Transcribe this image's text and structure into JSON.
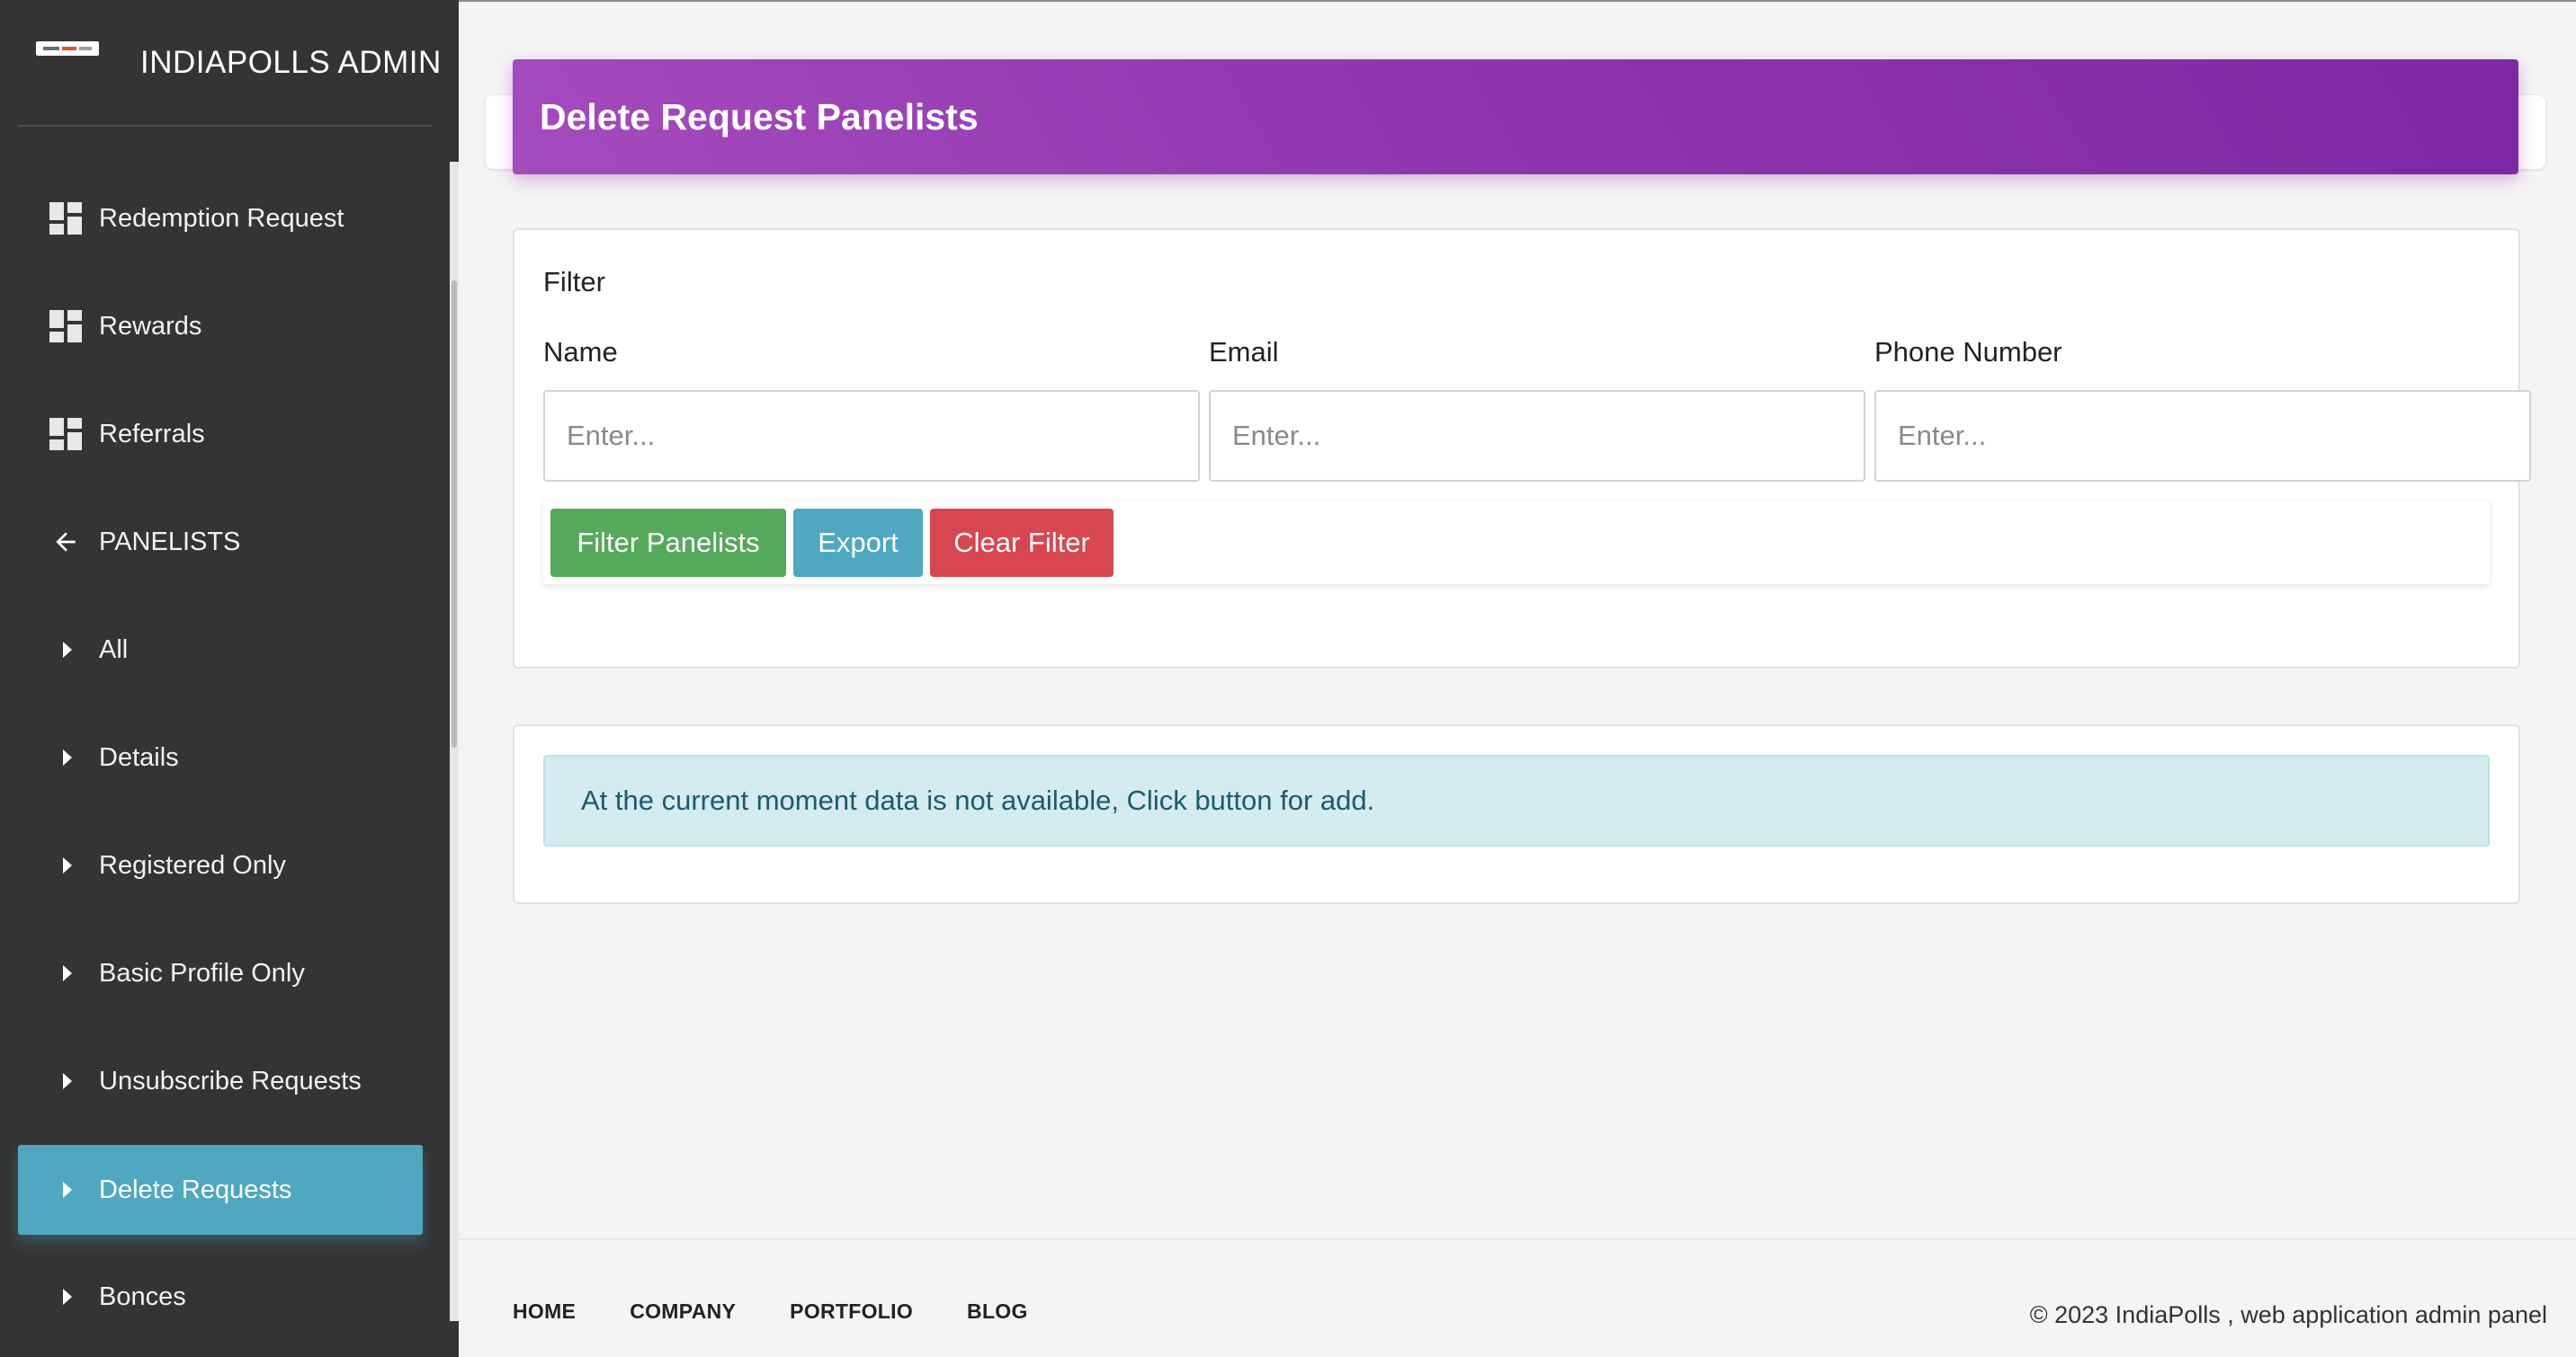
{
  "app": {
    "brand_title": "INDIAPOLLS ADMIN"
  },
  "sidebar": {
    "items": [
      {
        "label": "Redemption Request",
        "icon": "dashboard-icon"
      },
      {
        "label": "Rewards",
        "icon": "dashboard-icon"
      },
      {
        "label": "Referrals",
        "icon": "dashboard-icon"
      },
      {
        "label": "PANELISTS",
        "icon": "arrow-back-icon"
      },
      {
        "label": "All",
        "icon": "caret-right-icon"
      },
      {
        "label": "Details",
        "icon": "caret-right-icon"
      },
      {
        "label": "Registered Only",
        "icon": "caret-right-icon"
      },
      {
        "label": "Basic Profile Only",
        "icon": "caret-right-icon"
      },
      {
        "label": "Unsubscribe Requests",
        "icon": "caret-right-icon"
      },
      {
        "label": "Delete Requests",
        "icon": "caret-right-icon",
        "active": true
      },
      {
        "label": "Bonces",
        "icon": "caret-right-icon"
      }
    ]
  },
  "header": {
    "title": "Delete Request Panelists"
  },
  "filter": {
    "heading": "Filter",
    "fields": [
      {
        "label": "Name",
        "placeholder": "Enter...",
        "value": ""
      },
      {
        "label": "Email",
        "placeholder": "Enter...",
        "value": ""
      },
      {
        "label": "Phone Number",
        "placeholder": "Enter...",
        "value": ""
      }
    ],
    "buttons": {
      "filter": "Filter Panelists",
      "export": "Export",
      "clear": "Clear Filter"
    }
  },
  "data_panel": {
    "empty_message": "At the current moment data is not available, Click button for add."
  },
  "footer": {
    "links": [
      "HOME",
      "COMPANY",
      "PORTFOLIO",
      "BLOG"
    ],
    "copyright": "© 2023 IndiaPolls , web application admin panel"
  },
  "colors": {
    "sidebar_bg": "#343434",
    "active_item": "#4fa8c0",
    "header_gradient_start": "#a54bbd",
    "header_gradient_end": "#7d29a4",
    "btn_filter": "#55a95a",
    "btn_export": "#4fa8c0",
    "btn_clear": "#d8464f",
    "alert_bg": "#d4ebf0"
  }
}
